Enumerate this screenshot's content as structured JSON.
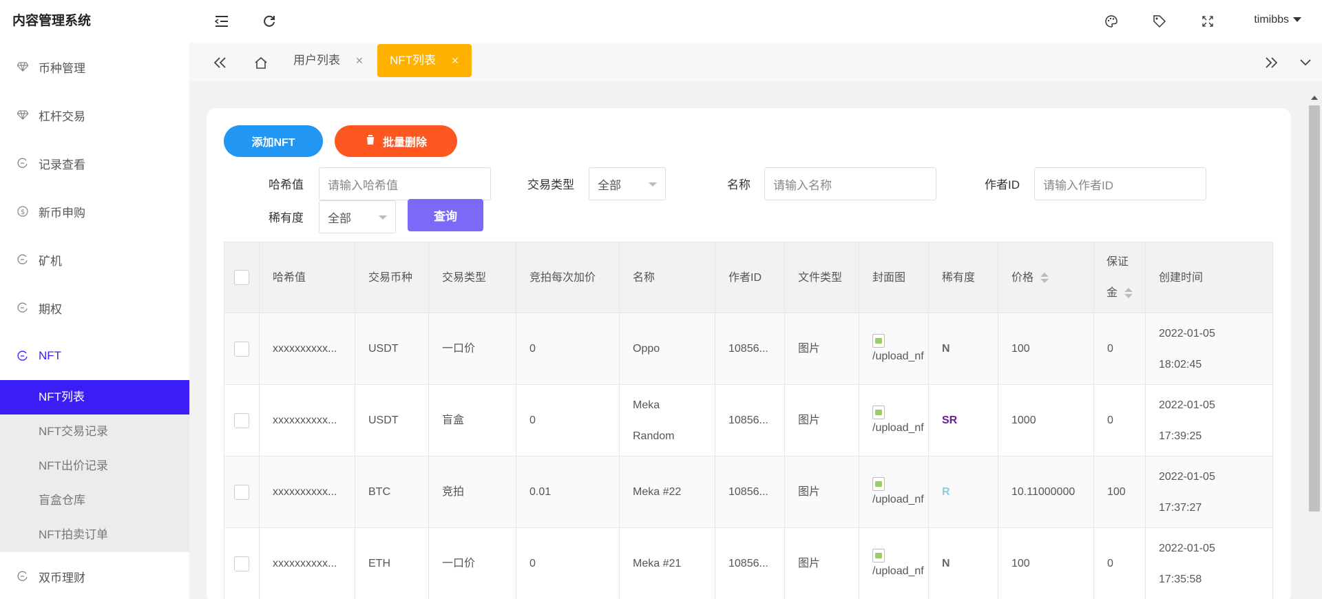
{
  "app": {
    "title": "内容管理系统",
    "user": "timibbs"
  },
  "sidebar": {
    "items": [
      {
        "label": "币种管理",
        "icon": "diamond-icon"
      },
      {
        "label": "杠杆交易",
        "icon": "diamond-icon"
      },
      {
        "label": "记录查看",
        "icon": "circle-arrow-icon"
      },
      {
        "label": "新币申购",
        "icon": "dollar-icon"
      },
      {
        "label": "矿机",
        "icon": "circle-arrow-icon"
      },
      {
        "label": "期权",
        "icon": "circle-arrow-icon"
      },
      {
        "label": "NFT",
        "icon": "circle-arrow-icon"
      }
    ],
    "nft_sub": [
      "NFT列表",
      "NFT交易记录",
      "NFT出价记录",
      "盲盒仓库",
      "NFT拍卖订单"
    ],
    "after": {
      "label": "双币理财",
      "icon": "circle-arrow-icon"
    }
  },
  "tabs": [
    {
      "label": "用户列表"
    },
    {
      "label": "NFT列表"
    }
  ],
  "toolbar": {
    "add_label": "添加NFT",
    "batch_delete_label": "批量删除",
    "query_label": "查询"
  },
  "filters": {
    "hash": {
      "label": "哈希值",
      "placeholder": "请输入哈希值"
    },
    "trade_type": {
      "label": "交易类型",
      "value": "全部"
    },
    "name": {
      "label": "名称",
      "placeholder": "请输入名称"
    },
    "author": {
      "label": "作者ID",
      "placeholder": "请输入作者ID"
    },
    "rarity": {
      "label": "稀有度",
      "value": "全部"
    }
  },
  "table": {
    "headers": [
      "哈希值",
      "交易币种",
      "交易类型",
      "竞拍每次加价",
      "名称",
      "作者ID",
      "文件类型",
      "封面图",
      "稀有度",
      "价格",
      "保证",
      "金",
      "创建时间"
    ],
    "rows": [
      {
        "hash": "xxxxxxxxxx...",
        "coin": "USDT",
        "type": "一口价",
        "increment": "0",
        "name1": "Oppo",
        "name2": "",
        "author": "10856...",
        "file": "图片",
        "cover": "/upload_nf",
        "rarity": "N",
        "rarity_color": "#666666",
        "price": "100",
        "deposit": "0",
        "date": "2022-01-05",
        "time": "18:02:45"
      },
      {
        "hash": "xxxxxxxxxx...",
        "coin": "USDT",
        "type": "盲盒",
        "increment": "0",
        "name1": "Meka",
        "name2": "Random",
        "author": "10856...",
        "file": "图片",
        "cover": "/upload_nf",
        "rarity": "SR",
        "rarity_color": "#6a1b9a",
        "price": "1000",
        "deposit": "0",
        "date": "2022-01-05",
        "time": "17:39:25"
      },
      {
        "hash": "xxxxxxxxxx...",
        "coin": "BTC",
        "type": "竞拍",
        "increment": "0.01",
        "name1": "Meka #22",
        "name2": "",
        "author": "10856...",
        "file": "图片",
        "cover": "/upload_nf",
        "rarity": "R",
        "rarity_color": "#8ec9e6",
        "price": "10.11000000",
        "deposit": "100",
        "date": "2022-01-05",
        "time": "17:37:27"
      },
      {
        "hash": "xxxxxxxxxx...",
        "coin": "ETH",
        "type": "一口价",
        "increment": "0",
        "name1": "Meka #21",
        "name2": "",
        "author": "10856...",
        "file": "图片",
        "cover": "/upload_nf",
        "rarity": "N",
        "rarity_color": "#666666",
        "price": "100",
        "deposit": "0",
        "date": "2022-01-05",
        "time": "17:35:58"
      }
    ]
  }
}
